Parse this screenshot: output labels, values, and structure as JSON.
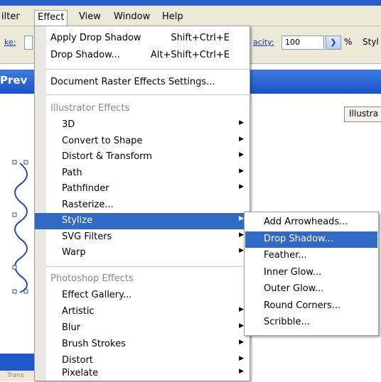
{
  "menubar": {
    "items": [
      {
        "label": "ilter"
      },
      {
        "label": "Effect"
      },
      {
        "label": "View"
      },
      {
        "label": "Window"
      },
      {
        "label": "Help"
      }
    ]
  },
  "controlbar": {
    "stroke_label": "ke:",
    "opacity_label": "acity:",
    "opacity_value": "100",
    "percent_sign": "%",
    "style_label": "Styl"
  },
  "panel": {
    "title": "Prev",
    "illustrator_button": "Illustra",
    "bottom_tab": "Trans"
  },
  "effect_menu": {
    "top_items": [
      {
        "label": "Apply Drop Shadow",
        "shortcut": "Shift+Ctrl+E"
      },
      {
        "label": "Drop Shadow...",
        "shortcut": "Alt+Shift+Ctrl+E"
      }
    ],
    "raster_settings": "Document Raster Effects Settings...",
    "illustrator_header": "Illustrator Effects",
    "illustrator_items": [
      {
        "label": "3D",
        "submenu": true
      },
      {
        "label": "Convert to Shape",
        "submenu": true
      },
      {
        "label": "Distort & Transform",
        "submenu": true
      },
      {
        "label": "Path",
        "submenu": true
      },
      {
        "label": "Pathfinder",
        "submenu": true
      },
      {
        "label": "Rasterize...",
        "submenu": false
      },
      {
        "label": "Stylize",
        "submenu": true,
        "highlighted": true
      },
      {
        "label": "SVG Filters",
        "submenu": true
      },
      {
        "label": "Warp",
        "submenu": true
      }
    ],
    "photoshop_header": "Photoshop Effects",
    "photoshop_items": [
      {
        "label": "Effect Gallery...",
        "submenu": false
      },
      {
        "label": "Artistic",
        "submenu": true
      },
      {
        "label": "Blur",
        "submenu": true
      },
      {
        "label": "Brush Strokes",
        "submenu": true
      },
      {
        "label": "Distort",
        "submenu": true
      },
      {
        "label": "Pixelate",
        "submenu": true
      }
    ],
    "submenu_arrow": "▶"
  },
  "stylize_submenu": {
    "items": [
      {
        "label": "Add Arrowheads..."
      },
      {
        "label": "Drop Shadow...",
        "highlighted": true
      },
      {
        "label": "Feather..."
      },
      {
        "label": "Inner Glow..."
      },
      {
        "label": "Outer Glow..."
      },
      {
        "label": "Round Corners..."
      },
      {
        "label": "Scribble..."
      }
    ]
  },
  "colors": {
    "highlight": "#316ac5",
    "titlebar_blue": "#1a52c7",
    "menubar_bg": "#ece9d8"
  }
}
